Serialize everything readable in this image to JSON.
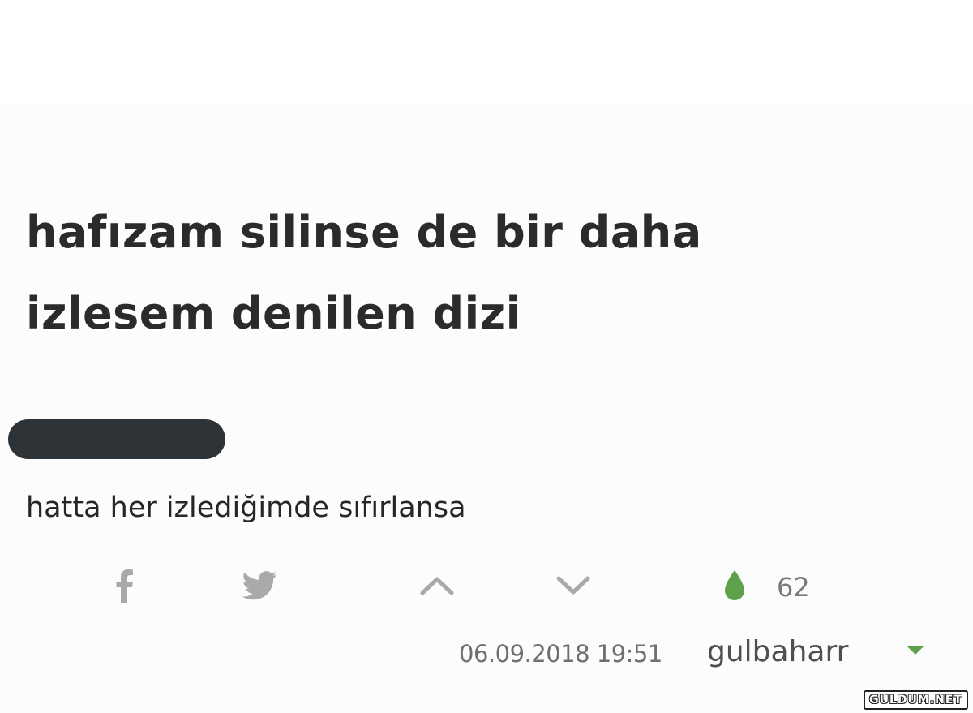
{
  "topic": {
    "title_line1": "hafızam silinse de bir daha",
    "title_line2": "izlesem denilen dizi"
  },
  "entry": {
    "text": "hatta her izlediğimde sıfırlansa",
    "favorite_count": "62",
    "date": "06.09.2018 19:51",
    "author": "gulbaharr"
  },
  "actions": {
    "facebook_icon": "facebook-f",
    "twitter_icon": "twitter-bird",
    "upvote_icon": "chevron-up",
    "downvote_icon": "chevron-down",
    "favorite_icon": "droplet",
    "author_menu_icon": "caret-down"
  },
  "colors": {
    "favorite_green": "#5fa04a",
    "icon_grey": "#a9a9a9",
    "redaction": "#2e3337"
  },
  "watermark": {
    "text": "GULDUM.NET"
  }
}
